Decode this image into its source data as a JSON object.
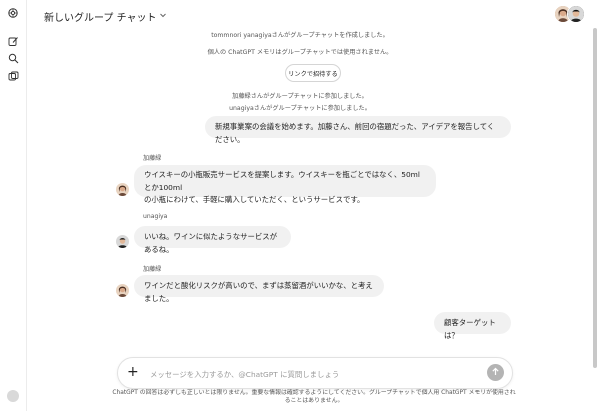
{
  "header": {
    "title": "新しいグループ チャット"
  },
  "system_messages": {
    "created": "tommnori yanagiyaさんがグループチャットを作成しました。",
    "memory_notice": "個人の ChatGPT メモリはグループチャットでは使用されません。",
    "invite_button": "リンクで招待する",
    "joined_1": "加藤緑さんがグループチャットに参加しました。",
    "joined_2": "unagiyaさんがグループチャットに参加しました。"
  },
  "messages": [
    {
      "sender": "",
      "text": "新規事業案の会議を始めます。加藤さん、前回の宿題だった、アイデアを報告してください。"
    },
    {
      "sender": "加藤緑",
      "text_line1": "ウイスキーの小瓶販売サービスを提案します。ウイスキーを瓶ごとではなく、50mlとか100ml",
      "text_line2": "の小瓶にわけて、手軽に購入していただく、というサービスです。"
    },
    {
      "sender": "unagiya",
      "text": "いいね。ワインに似たようなサービスがあるね。"
    },
    {
      "sender": "加藤緑",
      "text": "ワインだと酸化リスクが高いので、まずは蒸留酒がいいかな、と考えました。"
    },
    {
      "sender": "",
      "text": "顧客ターゲットは？"
    }
  ],
  "composer": {
    "placeholder": "メッセージを入力するか、@ChatGPT に質問しましょう",
    "plus": "+"
  },
  "disclaimer": "ChatGPT の回答は必ずしも正しいとは限りません。重要な情報は確認するようにしてください。グループチャットで個人用 ChatGPT メモリが使用されることはありません。",
  "icons": {
    "logo": "openai-logo-icon",
    "new_chat": "edit-icon",
    "search": "search-icon",
    "library": "images-icon",
    "chevron": "chevron-down-icon",
    "send": "arrow-up-icon"
  },
  "colors": {
    "bubble": "#f1f1f1",
    "send_button": "#b4b4b4",
    "text": "#1f1f1f"
  }
}
